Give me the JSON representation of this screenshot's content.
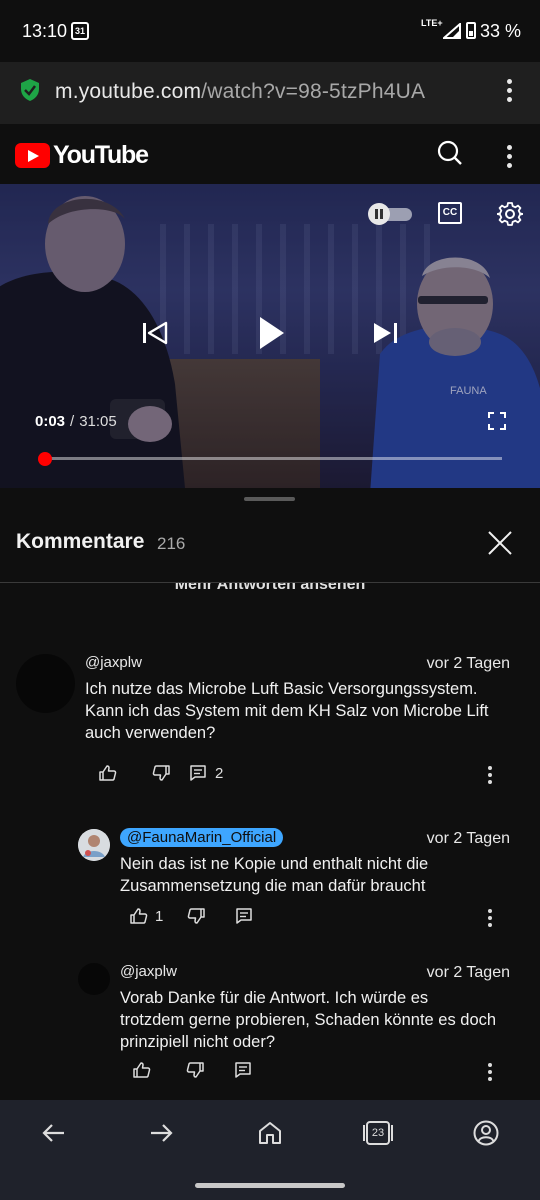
{
  "status": {
    "time": "13:10",
    "calendar_day": "31",
    "network": "LTE+",
    "battery": "33 %"
  },
  "browser": {
    "url_host": "m.youtube.com",
    "url_path": "/watch?v=98-5tzPh4UA"
  },
  "youtube": {
    "brand": "YouTube"
  },
  "player": {
    "cc_label": "CC",
    "current_time": "0:03",
    "separator": "/",
    "duration": "31:05",
    "progress_fraction": 0.0016
  },
  "comments_panel": {
    "title": "Kommentare",
    "count": "216",
    "more_replies": "Mehr Antworten ansehen",
    "comments": [
      {
        "author": "@jaxplw",
        "time": "vor 2 Tagen",
        "lines": [
          "Ich nutze das Microbe Luft Basic Versorgungssystem.",
          "Kann ich das System mit dem KH Salz von Microbe Lift",
          "auch verwenden?"
        ],
        "likes": "",
        "replies": "2"
      },
      {
        "author": "@FaunaMarin_Official",
        "time": "vor 2 Tagen",
        "lines": [
          "Nein das ist ne Kopie und enthalt nicht die",
          "Zusammensetzung die man dafür braucht"
        ],
        "likes": "1"
      },
      {
        "author": "@jaxplw",
        "time": "vor 2 Tagen",
        "lines": [
          "Vorab Danke für die Antwort. Ich würde es",
          "trotzdem gerne probieren, Schaden könnte es doch",
          "prinzipiell nicht oder?"
        ],
        "likes": ""
      }
    ]
  },
  "bottom_nav": {
    "tab_count": "23"
  },
  "colors": {
    "youtube_red": "#ff0000",
    "badge_blue": "#3ea6ff",
    "shield_green": "#1ea446"
  }
}
